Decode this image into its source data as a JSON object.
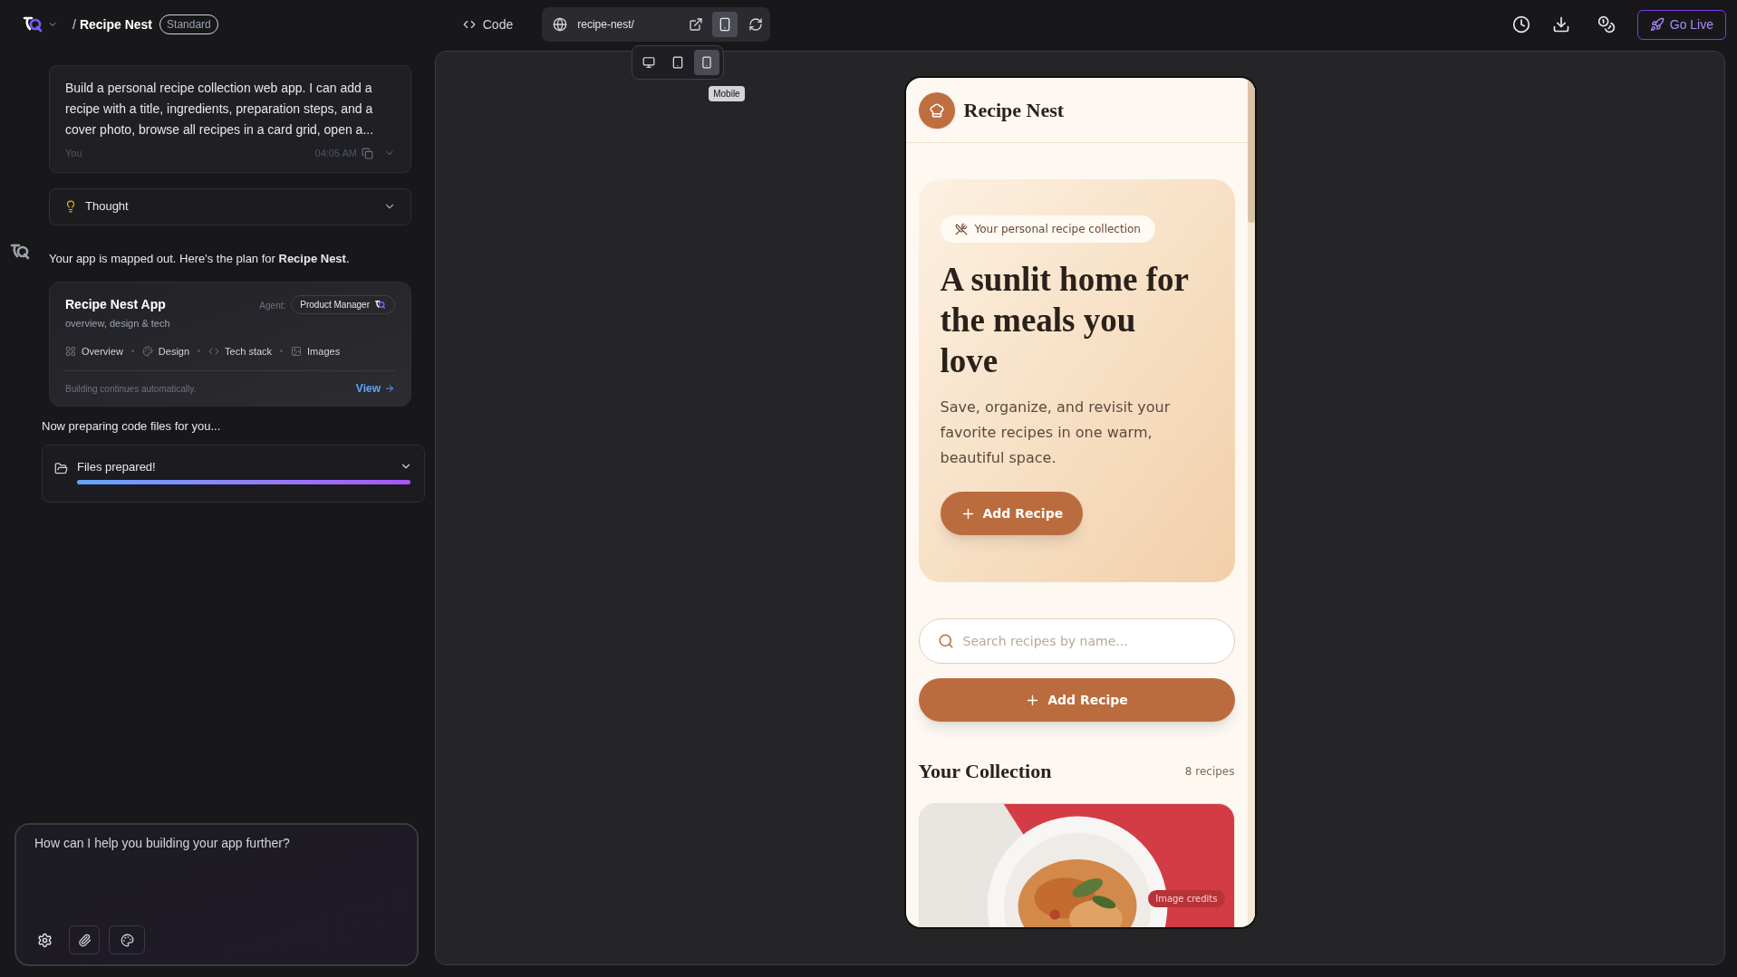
{
  "topbar": {
    "separator": "/",
    "project_name": "Recipe Nest",
    "plan_badge": "Standard",
    "code_tab": {
      "label": "Code",
      "selected": false
    },
    "url": "recipe-nest/",
    "device_menu": {
      "open": true,
      "tooltip": "Mobile",
      "options": [
        {
          "kind": "desktop",
          "selected": false
        },
        {
          "kind": "tablet",
          "selected": false
        },
        {
          "kind": "mobile",
          "selected": true
        }
      ]
    },
    "go_live": "Go Live"
  },
  "chat": {
    "user_message": {
      "text": "Build a personal recipe collection web app. I can add a recipe with a title, ingredients, preparation steps, and a cover photo, browse all recipes in a card grid, open a...",
      "author": "You",
      "time": "04:05 AM"
    },
    "thought": {
      "label": "Thought",
      "expanded": false
    },
    "assistant_text": "Your app is mapped out. Here's the plan for **Recipe Nest**.",
    "plan_card": {
      "title": "Recipe Nest App",
      "subtitle": "overview, design & tech",
      "agent_label": "Agent:",
      "agent": "Product Manager",
      "sections": [
        {
          "kind": "overview",
          "label": "Overview"
        },
        {
          "kind": "design",
          "label": "Design"
        },
        {
          "kind": "tech",
          "label": "Tech stack"
        },
        {
          "kind": "images",
          "label": "Images"
        }
      ],
      "footer": "Building continues automatically.",
      "view_link": "View"
    },
    "status_text": "Now preparing code files for you...",
    "files_card": {
      "label": "Files prepared!",
      "level": 1
    },
    "input": {
      "placeholder": "How can I help you building your app further?"
    }
  },
  "preview": {
    "app_name": "Recipe Nest",
    "hero": {
      "badge": "Your personal recipe collection",
      "heading": "A sunlit home for the meals you love",
      "text": "Save, organize, and revisit your favorite recipes in one warm, beautiful space.",
      "button": "Add Recipe"
    },
    "search": {
      "placeholder": "Search recipes by name..."
    },
    "add_button": "Add Recipe",
    "collection_title": "Your Collection",
    "count": "8 recipes",
    "card": {
      "kind": "picture",
      "credits": "Image credits"
    }
  }
}
